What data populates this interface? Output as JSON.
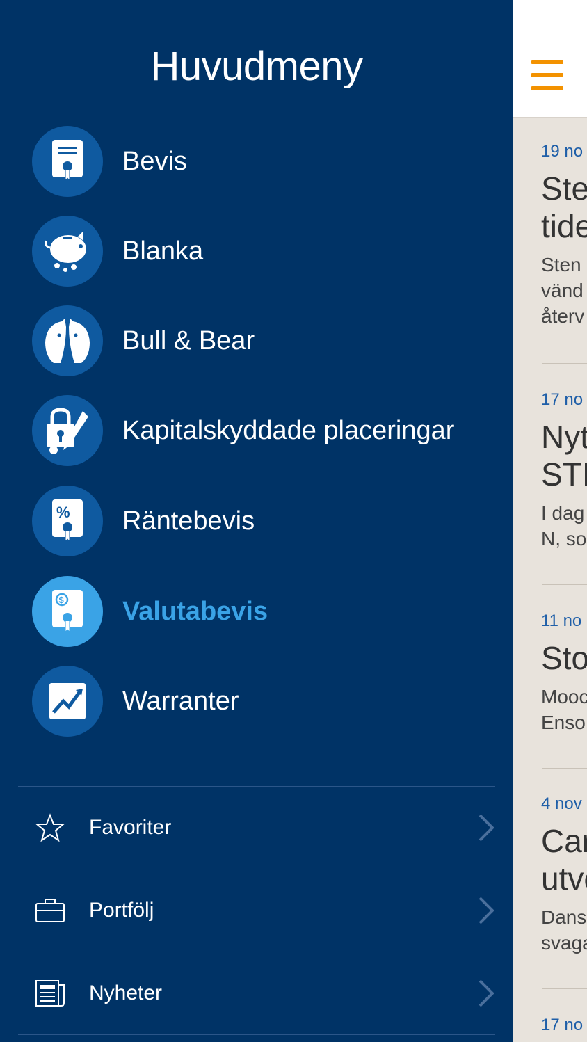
{
  "menu": {
    "title": "Huvudmeny",
    "items": [
      {
        "label": "Bevis",
        "icon": "certificate-icon"
      },
      {
        "label": "Blanka",
        "icon": "piggy-bank-icon"
      },
      {
        "label": "Bull & Bear",
        "icon": "bull-bear-icon"
      },
      {
        "label": "Kapitalskyddade placeringar",
        "icon": "lock-key-icon"
      },
      {
        "label": "Räntebevis",
        "icon": "percent-certificate-icon"
      },
      {
        "label": "Valutabevis",
        "icon": "currency-certificate-icon",
        "active": true
      },
      {
        "label": "Warranter",
        "icon": "chart-icon"
      }
    ],
    "secondary": [
      {
        "label": "Favoriter",
        "icon": "star-icon"
      },
      {
        "label": "Portfölj",
        "icon": "briefcase-icon"
      },
      {
        "label": "Nyheter",
        "icon": "newspaper-icon"
      }
    ]
  },
  "news": [
    {
      "date": "19 no",
      "title_1": "Ste",
      "title_2": "tide",
      "text_1": "Sten",
      "text_2": "vänd",
      "text_3": "återv"
    },
    {
      "date": "17 no",
      "title_1": "Nyt",
      "title_2": "STI",
      "text_1": "I dag",
      "text_2": "N, so"
    },
    {
      "date": "11 no",
      "title_1": "Sto",
      "text_1": "Mooc",
      "text_2": "Enso"
    },
    {
      "date": "4 nov",
      "title_1": "Car",
      "title_2": "utve",
      "text_1": "Dans",
      "text_2": "svaga"
    },
    {
      "date": "17 no"
    }
  ],
  "colors": {
    "menu_bg": "#003366",
    "icon_bg": "#0f5aa0",
    "active": "#3aa3e6",
    "hamburger": "#f39200",
    "content_bg": "#e8e3dc",
    "date_text": "#1f5fa8"
  }
}
